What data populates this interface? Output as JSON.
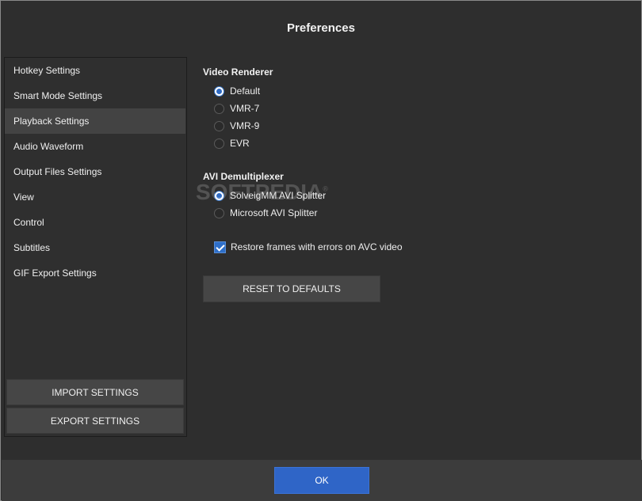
{
  "window": {
    "title": "Preferences"
  },
  "sidebar": {
    "items": [
      {
        "label": "Hotkey Settings"
      },
      {
        "label": "Smart Mode Settings"
      },
      {
        "label": "Playback Settings"
      },
      {
        "label": "Audio Waveform"
      },
      {
        "label": "Output Files Settings"
      },
      {
        "label": "View"
      },
      {
        "label": "Control"
      },
      {
        "label": "Subtitles"
      },
      {
        "label": "GIF Export Settings"
      }
    ],
    "active_item": "Playback Settings",
    "import_label": "IMPORT SETTINGS",
    "export_label": "EXPORT SETTINGS"
  },
  "video_renderer": {
    "title": "Video Renderer",
    "options": [
      "Default",
      "VMR-7",
      "VMR-9",
      "EVR"
    ],
    "selected": "Default"
  },
  "avi_demux": {
    "title": "AVI Demultiplexer",
    "options": [
      "SolveigMM AVI Splitter",
      "Microsoft AVI Splitter"
    ],
    "selected": "SolveigMM AVI Splitter"
  },
  "restore_frames": {
    "label": "Restore frames with errors on AVC video",
    "checked": true
  },
  "reset_label": "RESET TO DEFAULTS",
  "watermark": {
    "text": "SOFTPEDIA",
    "mark": "®"
  },
  "ok_label": "OK",
  "colors": {
    "accent": "#2f65c7",
    "background": "#2e2e2e",
    "active_item": "#434343"
  }
}
